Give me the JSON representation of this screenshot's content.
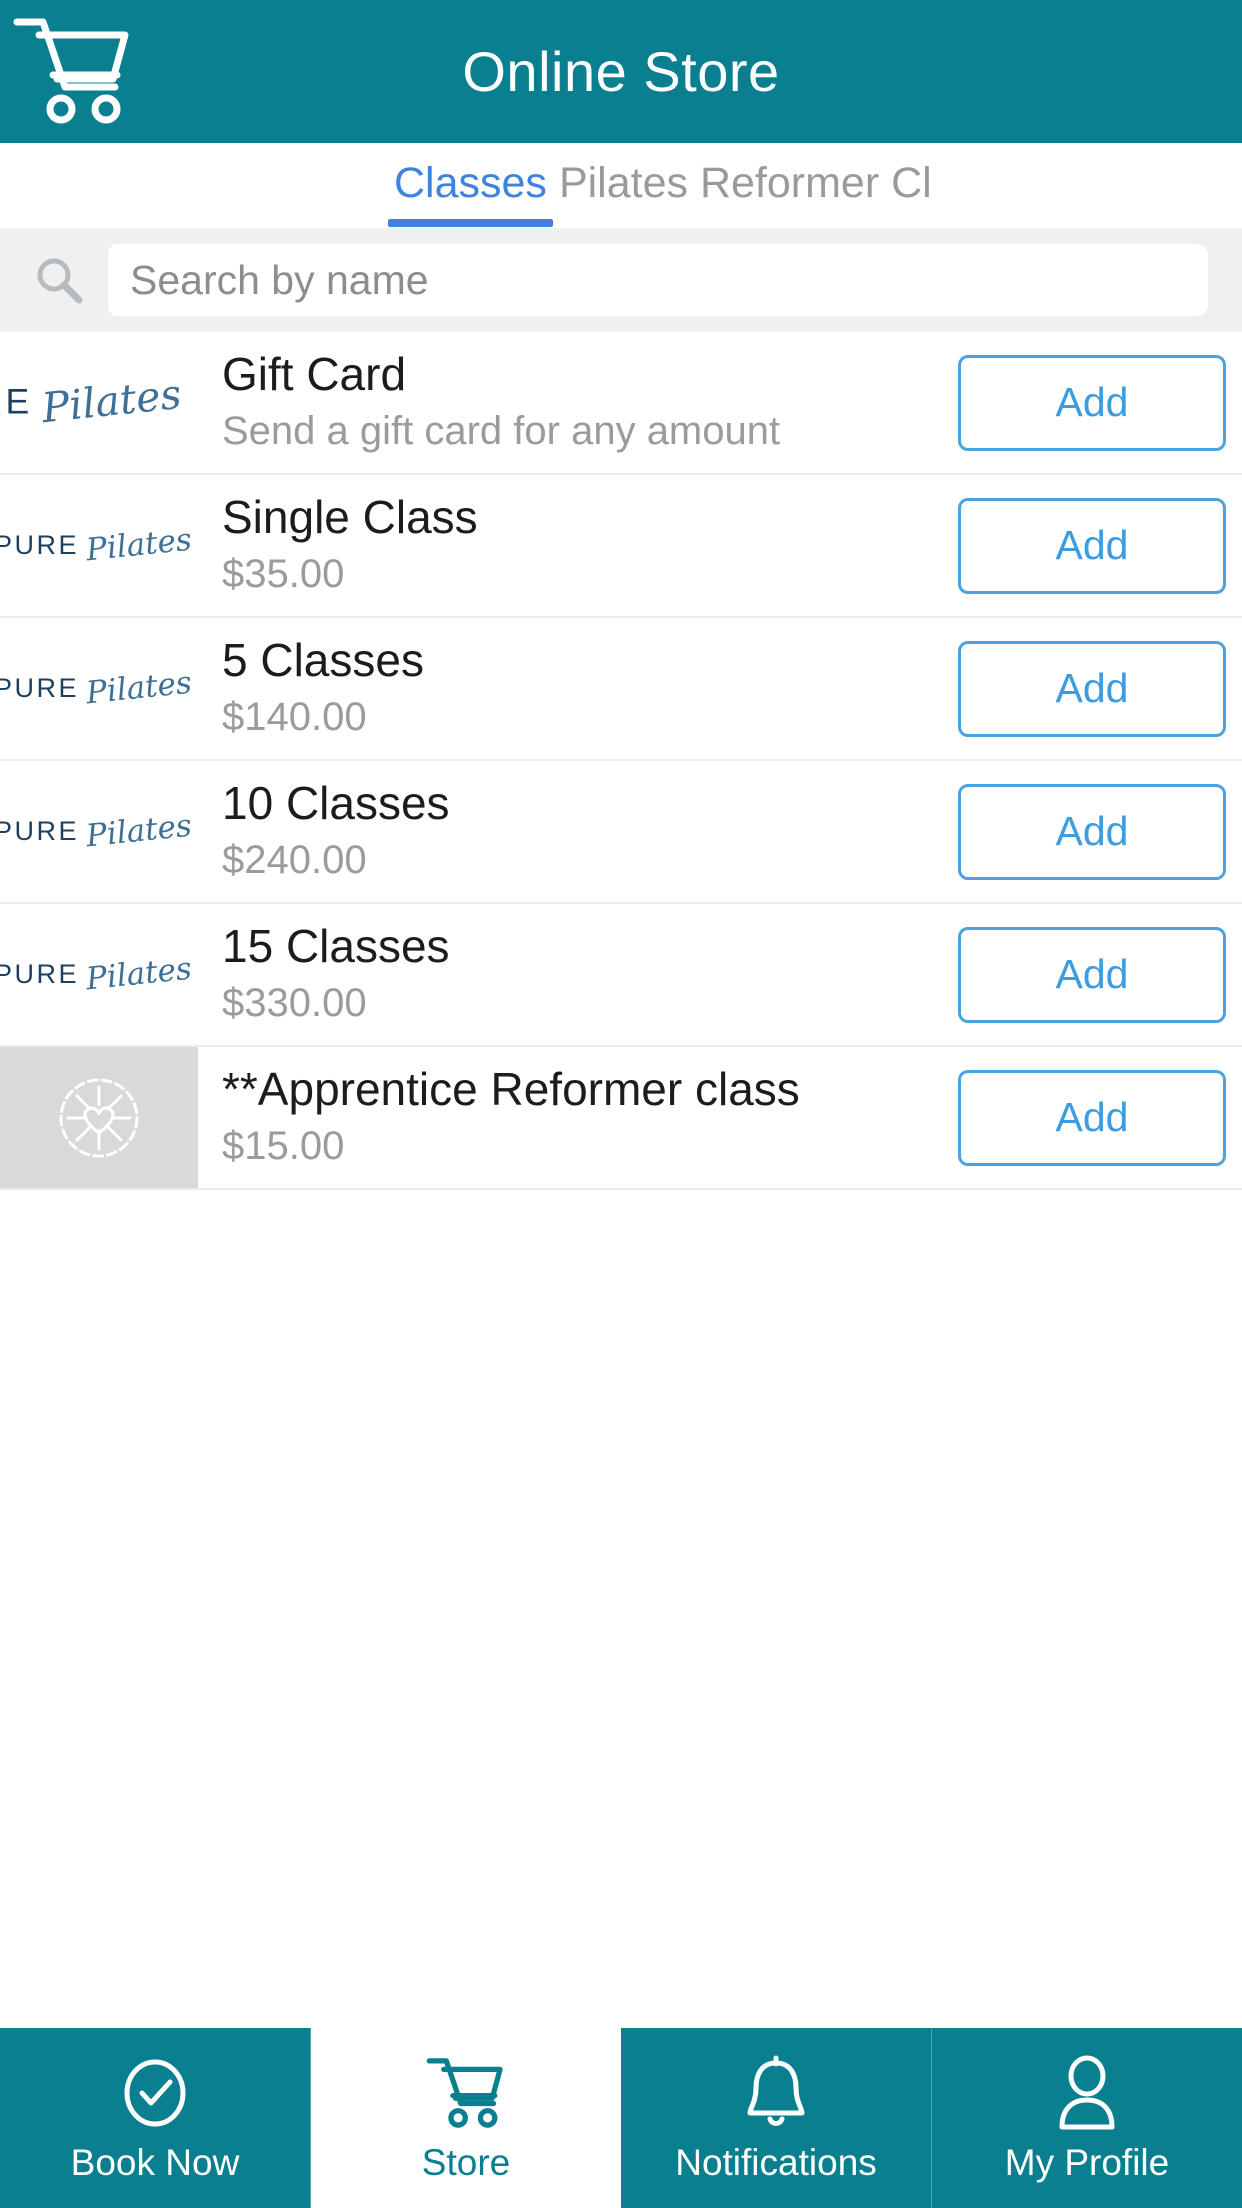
{
  "header": {
    "title": "Online Store",
    "cart_icon": "shopping-cart-icon",
    "bg_color": "#097F90"
  },
  "tabs": {
    "active_index": 0,
    "items": [
      {
        "label": "Classes",
        "active": true
      },
      {
        "label": "Pilates Reformer Cl",
        "active": false
      }
    ],
    "active_color": "#3f83df",
    "inactive_color": "#9a9a9a"
  },
  "search": {
    "placeholder": "Search by name",
    "value": "",
    "icon": "magnifier-icon"
  },
  "products": {
    "add_label": "Add",
    "accent_color": "#4aa3e0",
    "items": [
      {
        "title": "Gift Card",
        "subtitle": "Send a gift card for any amount",
        "logo_primary": "PURE",
        "logo_script": "Pilates",
        "thumb_type": "logo",
        "add_label": "Add"
      },
      {
        "title": "Single Class",
        "subtitle": "$35.00",
        "logo_primary": "PURE",
        "logo_script": "Pilates",
        "thumb_type": "logo",
        "add_label": "Add"
      },
      {
        "title": "5 Classes",
        "subtitle": "$140.00",
        "logo_primary": "PURE",
        "logo_script": "Pilates",
        "thumb_type": "logo",
        "add_label": "Add"
      },
      {
        "title": "10 Classes",
        "subtitle": "$240.00",
        "logo_primary": "PURE",
        "logo_script": "Pilates",
        "thumb_type": "logo",
        "add_label": "Add"
      },
      {
        "title": "15 Classes",
        "subtitle": "$330.00",
        "logo_primary": "PURE",
        "logo_script": "Pilates",
        "thumb_type": "logo",
        "add_label": "Add"
      },
      {
        "title": "**Apprentice Reformer class",
        "subtitle": "$15.00",
        "logo_primary": "",
        "logo_script": "",
        "thumb_type": "placeholder",
        "add_label": "Add"
      }
    ]
  },
  "bottom_nav": {
    "active_index": 1,
    "items": [
      {
        "label": "Book Now",
        "icon": "check-circle-icon",
        "active": false
      },
      {
        "label": "Store",
        "icon": "shopping-cart-icon",
        "active": true
      },
      {
        "label": "Notifications",
        "icon": "bell-icon",
        "active": false
      },
      {
        "label": "My Profile",
        "icon": "person-icon",
        "active": false
      }
    ]
  }
}
